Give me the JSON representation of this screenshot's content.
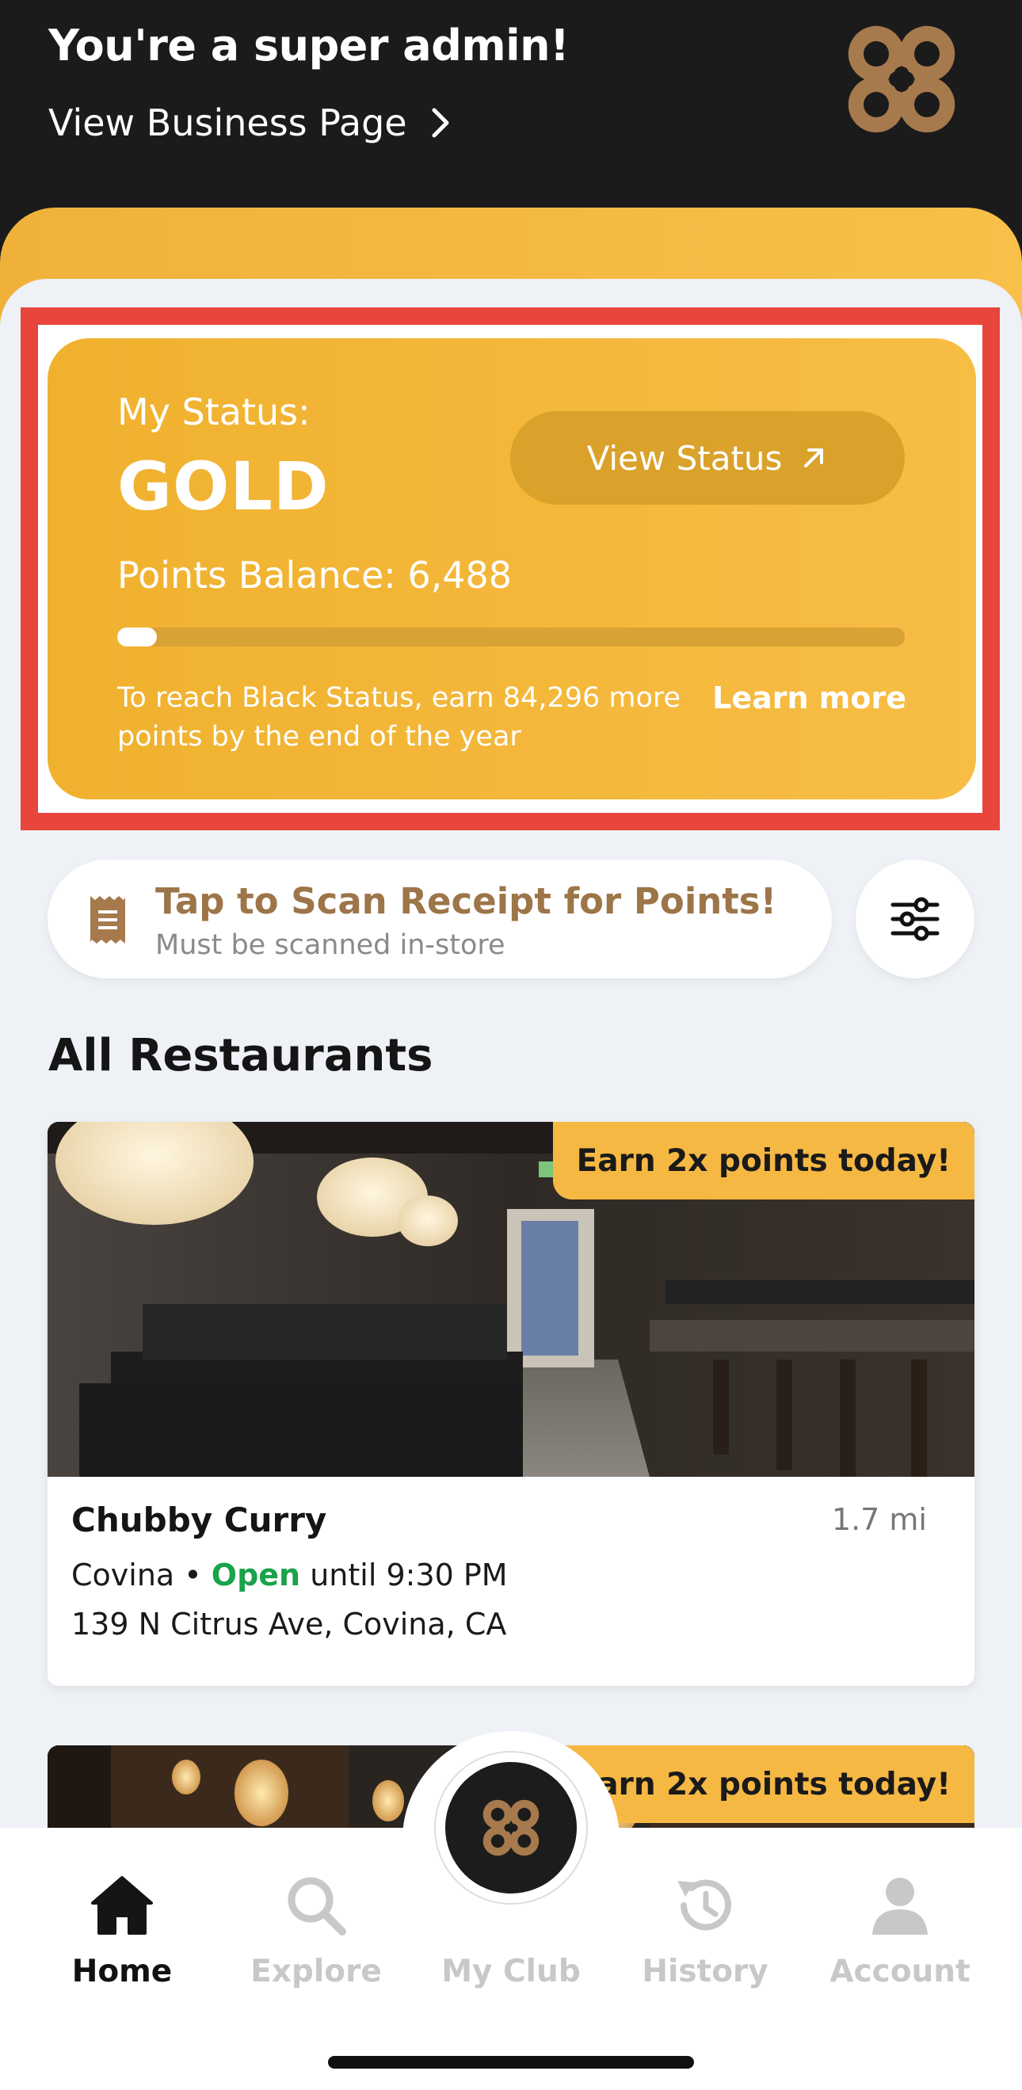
{
  "header": {
    "title": "You're a super admin!",
    "view_business_link": "View Business Page",
    "logo_icon": "brand-cross-logo"
  },
  "status_card": {
    "label": "My Status:",
    "tier": "GOLD",
    "view_status_label": "View Status",
    "points_balance_text": "Points Balance: 6,488",
    "progress_fraction": 0.05,
    "reach_text": "To reach Black Status, earn 84,296 more points by the end of the year",
    "learn_more_label": "Learn more"
  },
  "scan": {
    "title": "Tap to Scan Receipt for Points!",
    "subtitle": "Must be scanned in-store",
    "icon": "receipt-icon",
    "filter_icon": "sliders-icon"
  },
  "section_title": "All Restaurants",
  "restaurants": [
    {
      "name": "Chubby Curry",
      "distance": "1.7 mi",
      "city": "Covina",
      "separator": " • ",
      "open_label": "Open",
      "hours": " until 9:30 PM",
      "address": "139 N Citrus Ave, Covina, CA",
      "promo": "Earn 2x points today!"
    },
    {
      "promo": "Earn 2x points today!"
    }
  ],
  "bottom_nav": {
    "items": [
      {
        "label": "Home",
        "icon": "home-icon",
        "active": true
      },
      {
        "label": "Explore",
        "icon": "search-icon",
        "active": false
      },
      {
        "label": "My Club",
        "icon": "brand-cross-logo",
        "active": false
      },
      {
        "label": "History",
        "icon": "history-icon",
        "active": false
      },
      {
        "label": "Account",
        "icon": "account-icon",
        "active": false
      }
    ]
  },
  "colors": {
    "gold": "#f0b12e",
    "highlight_red": "#e8453c",
    "brand_brown": "#9c7548",
    "open_green": "#19a34a",
    "header_bg": "#1b1b1b"
  }
}
